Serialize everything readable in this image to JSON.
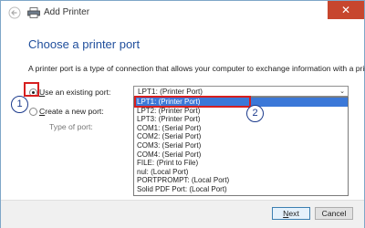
{
  "window": {
    "title": "Add Printer",
    "close_glyph": "✕"
  },
  "page": {
    "heading": "Choose a printer port",
    "description": "A printer port is a type of connection that allows your computer to exchange information with a printer."
  },
  "options": {
    "use_existing_label": "Use an existing port:",
    "use_existing_mnemonic": "U",
    "create_new_label": "Create a new port:",
    "create_new_mnemonic": "C",
    "type_of_port_label": "Type of port:"
  },
  "port_select": {
    "value": "LPT1: (Printer Port)",
    "arrow": "⌄",
    "items": [
      "LPT1: (Printer Port)",
      "LPT2: (Printer Port)",
      "LPT3: (Printer Port)",
      "COM1: (Serial Port)",
      "COM2: (Serial Port)",
      "COM3: (Serial Port)",
      "COM4: (Serial Port)",
      "FILE: (Print to File)",
      "nul: (Local Port)",
      "PORTPROMPT: (Local Port)",
      "Solid PDF Port: (Local Port)"
    ],
    "selected_index": 0
  },
  "callouts": [
    "1",
    "2"
  ],
  "buttons": {
    "next": "Next",
    "cancel": "Cancel"
  },
  "colors": {
    "heading": "#1f4e9c",
    "highlight": "#3b78d8",
    "annotation_red": "#d61f1f",
    "callout_blue": "#1b3a8c",
    "close_red": "#c7462e"
  },
  "icons": {
    "back": "back-arrow-icon",
    "printer": "printer-icon"
  }
}
